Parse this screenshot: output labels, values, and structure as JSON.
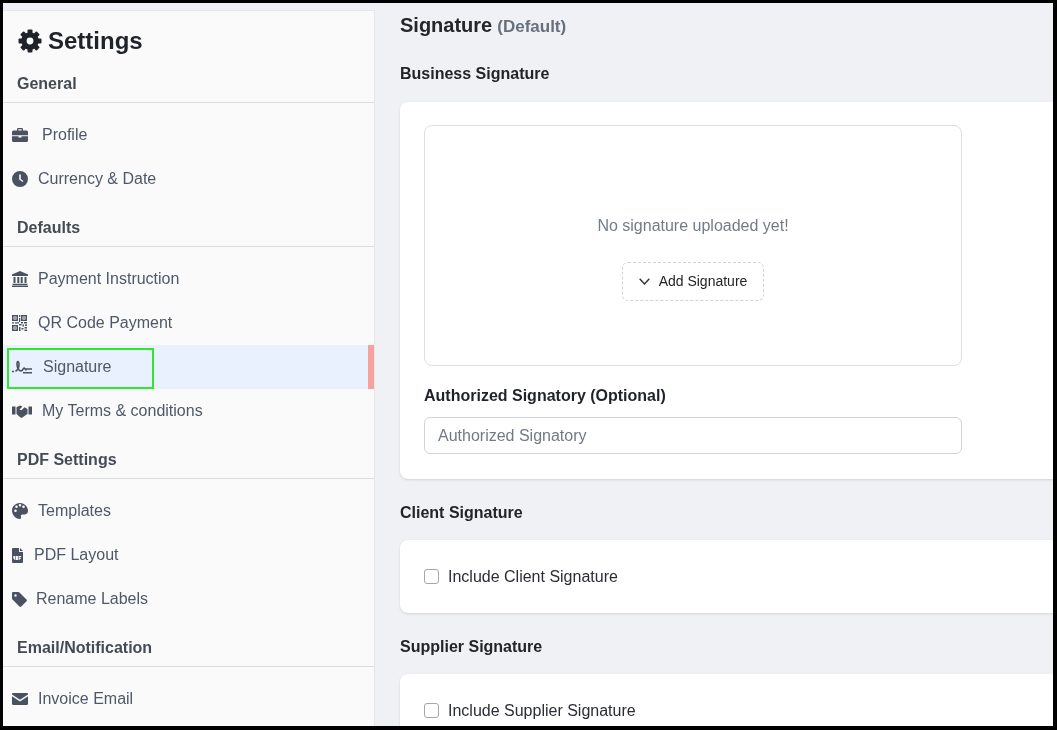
{
  "sidebar": {
    "title": "Settings",
    "sections": [
      {
        "heading": "General",
        "items": [
          {
            "label": "Profile",
            "selected": false,
            "highlighted": false
          },
          {
            "label": "Currency & Date",
            "selected": false,
            "highlighted": false
          }
        ]
      },
      {
        "heading": "Defaults",
        "items": [
          {
            "label": "Payment Instruction",
            "selected": false,
            "highlighted": false
          },
          {
            "label": "QR Code Payment",
            "selected": false,
            "highlighted": false
          },
          {
            "label": "Signature",
            "selected": true,
            "highlighted": true
          },
          {
            "label": "My Terms & conditions",
            "selected": false,
            "highlighted": false
          }
        ]
      },
      {
        "heading": "PDF Settings",
        "items": [
          {
            "label": "Templates",
            "selected": false,
            "highlighted": false
          },
          {
            "label": "PDF Layout",
            "selected": false,
            "highlighted": false
          },
          {
            "label": "Rename Labels",
            "selected": false,
            "highlighted": false
          }
        ]
      },
      {
        "heading": "Email/Notification",
        "items": [
          {
            "label": "Invoice Email",
            "selected": false,
            "highlighted": false
          }
        ]
      }
    ]
  },
  "main": {
    "title": "Signature",
    "subtitle": "(Default)",
    "sections": [
      {
        "kind": "upload",
        "heading": "Business Signature",
        "empty_message": "No signature uploaded yet!",
        "button": "Add Signature",
        "field": {
          "label": "Authorized Signatory (Optional)",
          "placeholder": "Authorized Signatory"
        }
      },
      {
        "kind": "checkbox",
        "heading": "Client Signature",
        "checkbox": {
          "label": "Include Client Signature",
          "checked": false
        }
      },
      {
        "kind": "checkbox",
        "heading": "Supplier Signature",
        "checkbox": {
          "label": "Include Supplier Signature",
          "checked": false
        }
      }
    ]
  }
}
